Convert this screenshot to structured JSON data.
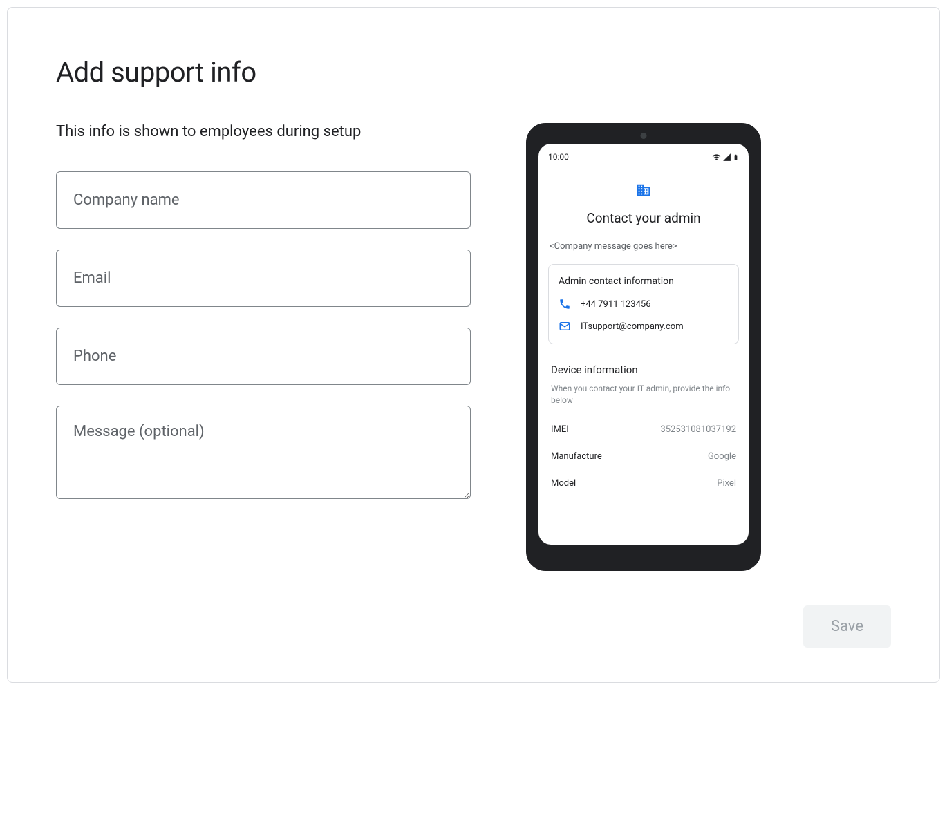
{
  "page": {
    "title": "Add support info",
    "subtitle": "This info is shown to employees during setup"
  },
  "form": {
    "company_placeholder": "Company name",
    "email_placeholder": "Email",
    "phone_placeholder": "Phone",
    "message_placeholder": "Message (optional)"
  },
  "preview": {
    "time": "10:00",
    "screen_title": "Contact your admin",
    "company_message": "<Company message goes here>",
    "contact_card_title": "Admin contact information",
    "contact_phone": "+44 7911 123456",
    "contact_email": "ITsupport@company.com",
    "device_title": "Device information",
    "device_hint": "When you contact your IT admin, provide the info below",
    "device_rows": [
      {
        "label": "IMEI",
        "value": "352531081037192"
      },
      {
        "label": "Manufacture",
        "value": "Google"
      },
      {
        "label": "Model",
        "value": "Pixel"
      }
    ]
  },
  "actions": {
    "save_label": "Save"
  }
}
